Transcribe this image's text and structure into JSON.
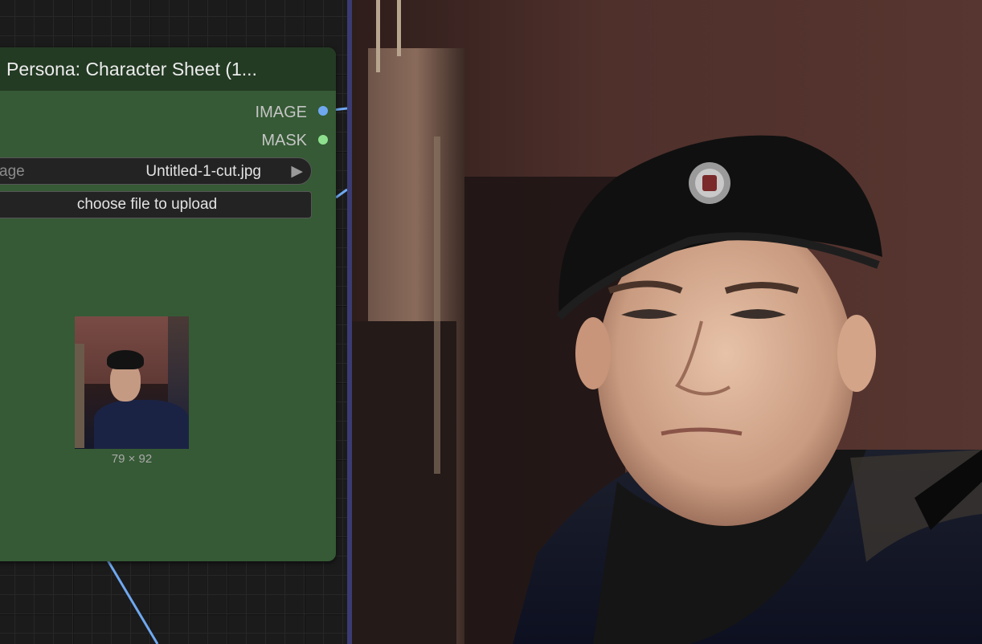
{
  "node": {
    "title": "Persona: Character Sheet (1...",
    "outputs": [
      {
        "label": "IMAGE",
        "color": "#6fa8f0"
      },
      {
        "label": "MASK",
        "color": "#8ee08e"
      }
    ],
    "image_widget": {
      "label": "image",
      "value": "Untitled-1-cut.jpg"
    },
    "upload_button": "choose file to upload",
    "thumbnail_size": "79 × 92"
  },
  "colors": {
    "node_body": "#355a35",
    "node_title": "#233a23",
    "link_blue": "#6fa8f0",
    "divider": "#3a3b73"
  }
}
